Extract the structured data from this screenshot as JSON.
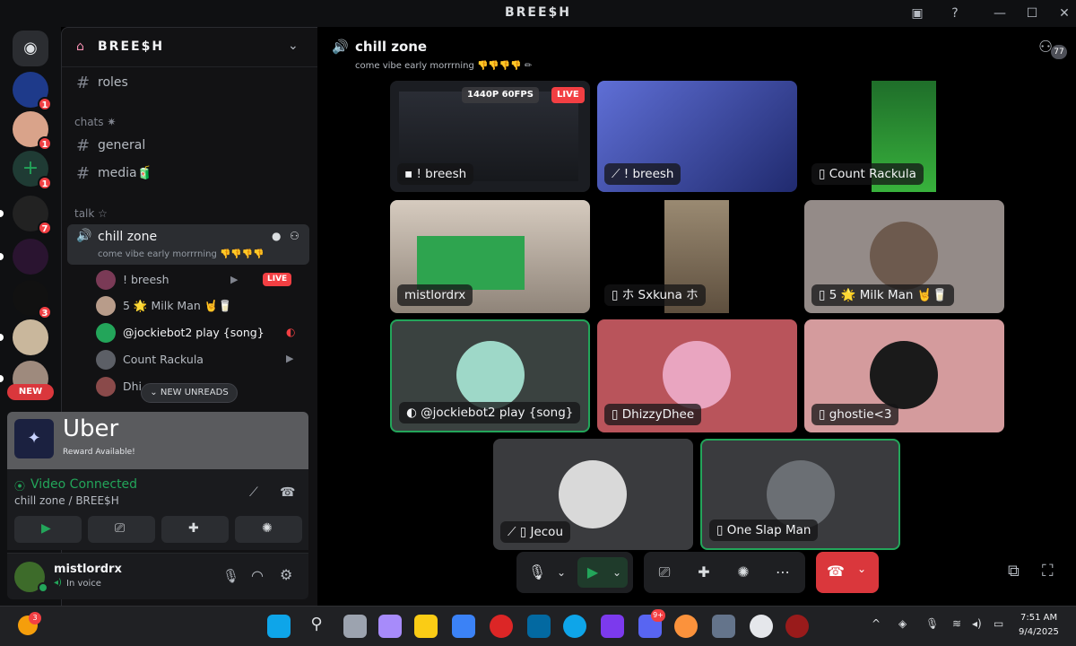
{
  "window": {
    "title": "BREE$H"
  },
  "server": {
    "name": "BREE$H"
  },
  "sidebar": {
    "channels": [
      {
        "name": "roles"
      },
      {
        "name": "general"
      },
      {
        "name": "media🧃"
      }
    ],
    "categories": {
      "chats": "chats ✷",
      "talk": "talk ☆"
    },
    "voice_channel": {
      "name": "chill zone",
      "status": "come vibe early morrrning 👎👎👎👎"
    },
    "voice_users": [
      {
        "name": "! breesh",
        "badge": "LIVE"
      },
      {
        "name": "5 🌟 Milk Man 🤘🥛"
      },
      {
        "name": "@jockiebot2 play {song}"
      },
      {
        "name": "Count Rackula"
      },
      {
        "name": "Dhi"
      }
    ],
    "new_unreads": "NEW UNREADS",
    "new_badge": "NEW"
  },
  "rail": {
    "badges": [
      "1",
      "1",
      "1",
      "7",
      "3"
    ]
  },
  "promo": {
    "brand": "Uber",
    "sub": "Reward Available!"
  },
  "voice_panel": {
    "status": "Video Connected",
    "location": "chill zone / BREE$H"
  },
  "user": {
    "name": "mistlordrx",
    "status": "In voice"
  },
  "main": {
    "channel": "chill zone",
    "topic": "come vibe early morrrning 👎👎👎👎 ✏",
    "stream_quality": "1440P 60FPS",
    "live": "LIVE",
    "member_count": "77",
    "tiles": [
      {
        "name": "! breesh"
      },
      {
        "name": "! breesh"
      },
      {
        "name": "Count Rackula"
      },
      {
        "name": "mistlordrx"
      },
      {
        "name": "ホ Sxkuna ホ"
      },
      {
        "name": "5 🌟 Milk Man 🤘🥛"
      },
      {
        "name": "@jockiebot2 play {song}"
      },
      {
        "name": "DhizzyDhee"
      },
      {
        "name": "ghostie<3"
      },
      {
        "name": "Jecou"
      },
      {
        "name": "One Slap Man"
      }
    ]
  },
  "taskbar": {
    "time": "7:51 AM",
    "date": "9/4/2025",
    "discord_badge": "9+",
    "weather_badge": "3"
  },
  "colors": {
    "accent_green": "#23a55a",
    "danger": "#da373c",
    "live": "#f23f43"
  }
}
